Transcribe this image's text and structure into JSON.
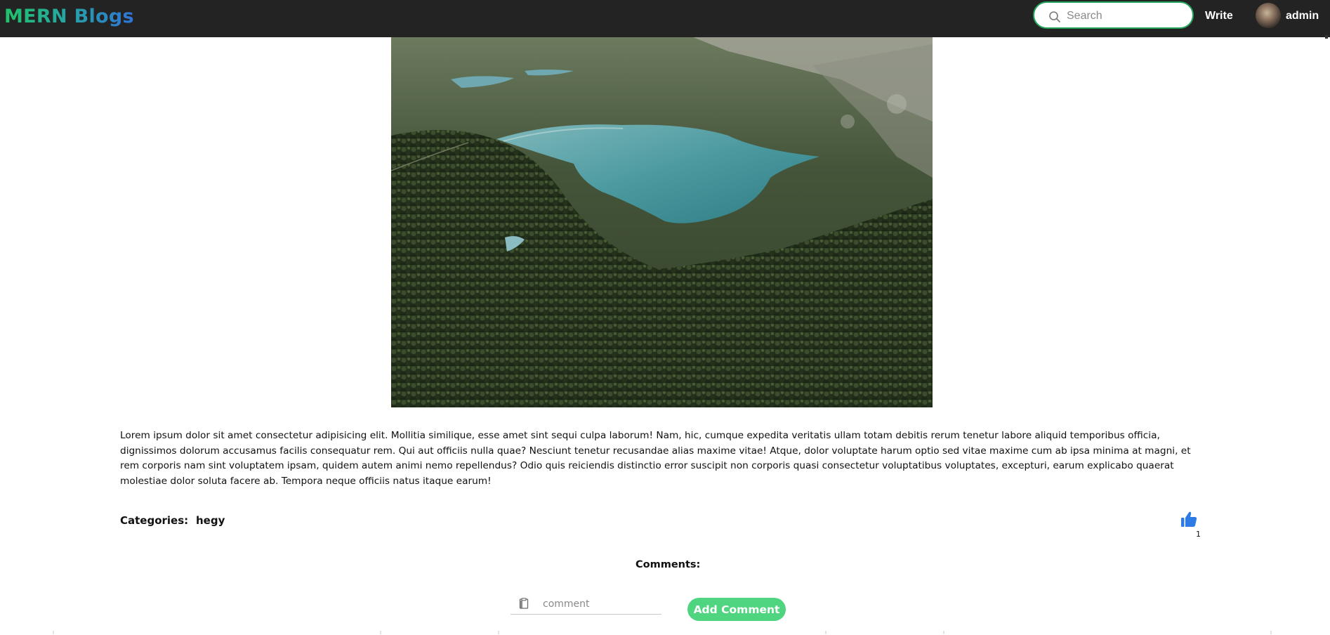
{
  "header": {
    "brand": "MERN Blogs",
    "search_placeholder": "Search",
    "write_label": "Write",
    "username": "admin"
  },
  "post": {
    "body": "Lorem ipsum dolor sit amet consectetur adipisicing elit. Mollitia similique, esse amet sint sequi culpa laborum! Nam, hic, cumque expedita veritatis ullam totam debitis rerum tenetur labore aliquid temporibus officia, dignissimos dolorum accusamus facilis consequatur rem. Qui aut officiis nulla quae? Nesciunt tenetur recusandae alias maxime vitae! Atque, dolor voluptate harum optio sed vitae maxime cum ab ipsa minima at magni, et rem corporis nam sint voluptatem ipsam, quidem autem animi nemo repellendus? Odio quis reiciendis distinctio error suscipit non corporis quasi consectetur voluptatibus voluptates, excepturi, earum explicabo quaerat molestiae dolor soluta facere ab. Tempora neque officiis natus itaque earum!",
    "categories_label": "Categories:",
    "category": "hegy",
    "like_count": "1"
  },
  "comments": {
    "title": "Comments:",
    "input_placeholder": "comment",
    "add_button": "Add Comment"
  },
  "colors": {
    "header_bg": "#232323",
    "accent_green": "#4fd47f",
    "like_blue": "#2f7be5"
  }
}
